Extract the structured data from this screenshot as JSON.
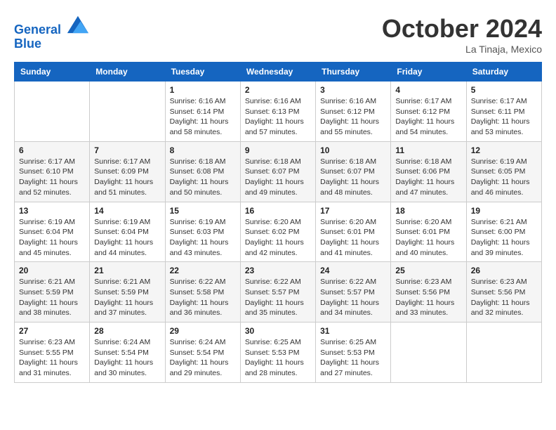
{
  "header": {
    "logo_line1": "General",
    "logo_line2": "Blue",
    "month": "October 2024",
    "location": "La Tinaja, Mexico"
  },
  "weekdays": [
    "Sunday",
    "Monday",
    "Tuesday",
    "Wednesday",
    "Thursday",
    "Friday",
    "Saturday"
  ],
  "weeks": [
    [
      {
        "day": "",
        "info": ""
      },
      {
        "day": "",
        "info": ""
      },
      {
        "day": "1",
        "info": "Sunrise: 6:16 AM\nSunset: 6:14 PM\nDaylight: 11 hours and 58 minutes."
      },
      {
        "day": "2",
        "info": "Sunrise: 6:16 AM\nSunset: 6:13 PM\nDaylight: 11 hours and 57 minutes."
      },
      {
        "day": "3",
        "info": "Sunrise: 6:16 AM\nSunset: 6:12 PM\nDaylight: 11 hours and 55 minutes."
      },
      {
        "day": "4",
        "info": "Sunrise: 6:17 AM\nSunset: 6:12 PM\nDaylight: 11 hours and 54 minutes."
      },
      {
        "day": "5",
        "info": "Sunrise: 6:17 AM\nSunset: 6:11 PM\nDaylight: 11 hours and 53 minutes."
      }
    ],
    [
      {
        "day": "6",
        "info": "Sunrise: 6:17 AM\nSunset: 6:10 PM\nDaylight: 11 hours and 52 minutes."
      },
      {
        "day": "7",
        "info": "Sunrise: 6:17 AM\nSunset: 6:09 PM\nDaylight: 11 hours and 51 minutes."
      },
      {
        "day": "8",
        "info": "Sunrise: 6:18 AM\nSunset: 6:08 PM\nDaylight: 11 hours and 50 minutes."
      },
      {
        "day": "9",
        "info": "Sunrise: 6:18 AM\nSunset: 6:07 PM\nDaylight: 11 hours and 49 minutes."
      },
      {
        "day": "10",
        "info": "Sunrise: 6:18 AM\nSunset: 6:07 PM\nDaylight: 11 hours and 48 minutes."
      },
      {
        "day": "11",
        "info": "Sunrise: 6:18 AM\nSunset: 6:06 PM\nDaylight: 11 hours and 47 minutes."
      },
      {
        "day": "12",
        "info": "Sunrise: 6:19 AM\nSunset: 6:05 PM\nDaylight: 11 hours and 46 minutes."
      }
    ],
    [
      {
        "day": "13",
        "info": "Sunrise: 6:19 AM\nSunset: 6:04 PM\nDaylight: 11 hours and 45 minutes."
      },
      {
        "day": "14",
        "info": "Sunrise: 6:19 AM\nSunset: 6:04 PM\nDaylight: 11 hours and 44 minutes."
      },
      {
        "day": "15",
        "info": "Sunrise: 6:19 AM\nSunset: 6:03 PM\nDaylight: 11 hours and 43 minutes."
      },
      {
        "day": "16",
        "info": "Sunrise: 6:20 AM\nSunset: 6:02 PM\nDaylight: 11 hours and 42 minutes."
      },
      {
        "day": "17",
        "info": "Sunrise: 6:20 AM\nSunset: 6:01 PM\nDaylight: 11 hours and 41 minutes."
      },
      {
        "day": "18",
        "info": "Sunrise: 6:20 AM\nSunset: 6:01 PM\nDaylight: 11 hours and 40 minutes."
      },
      {
        "day": "19",
        "info": "Sunrise: 6:21 AM\nSunset: 6:00 PM\nDaylight: 11 hours and 39 minutes."
      }
    ],
    [
      {
        "day": "20",
        "info": "Sunrise: 6:21 AM\nSunset: 5:59 PM\nDaylight: 11 hours and 38 minutes."
      },
      {
        "day": "21",
        "info": "Sunrise: 6:21 AM\nSunset: 5:59 PM\nDaylight: 11 hours and 37 minutes."
      },
      {
        "day": "22",
        "info": "Sunrise: 6:22 AM\nSunset: 5:58 PM\nDaylight: 11 hours and 36 minutes."
      },
      {
        "day": "23",
        "info": "Sunrise: 6:22 AM\nSunset: 5:57 PM\nDaylight: 11 hours and 35 minutes."
      },
      {
        "day": "24",
        "info": "Sunrise: 6:22 AM\nSunset: 5:57 PM\nDaylight: 11 hours and 34 minutes."
      },
      {
        "day": "25",
        "info": "Sunrise: 6:23 AM\nSunset: 5:56 PM\nDaylight: 11 hours and 33 minutes."
      },
      {
        "day": "26",
        "info": "Sunrise: 6:23 AM\nSunset: 5:56 PM\nDaylight: 11 hours and 32 minutes."
      }
    ],
    [
      {
        "day": "27",
        "info": "Sunrise: 6:23 AM\nSunset: 5:55 PM\nDaylight: 11 hours and 31 minutes."
      },
      {
        "day": "28",
        "info": "Sunrise: 6:24 AM\nSunset: 5:54 PM\nDaylight: 11 hours and 30 minutes."
      },
      {
        "day": "29",
        "info": "Sunrise: 6:24 AM\nSunset: 5:54 PM\nDaylight: 11 hours and 29 minutes."
      },
      {
        "day": "30",
        "info": "Sunrise: 6:25 AM\nSunset: 5:53 PM\nDaylight: 11 hours and 28 minutes."
      },
      {
        "day": "31",
        "info": "Sunrise: 6:25 AM\nSunset: 5:53 PM\nDaylight: 11 hours and 27 minutes."
      },
      {
        "day": "",
        "info": ""
      },
      {
        "day": "",
        "info": ""
      }
    ]
  ]
}
